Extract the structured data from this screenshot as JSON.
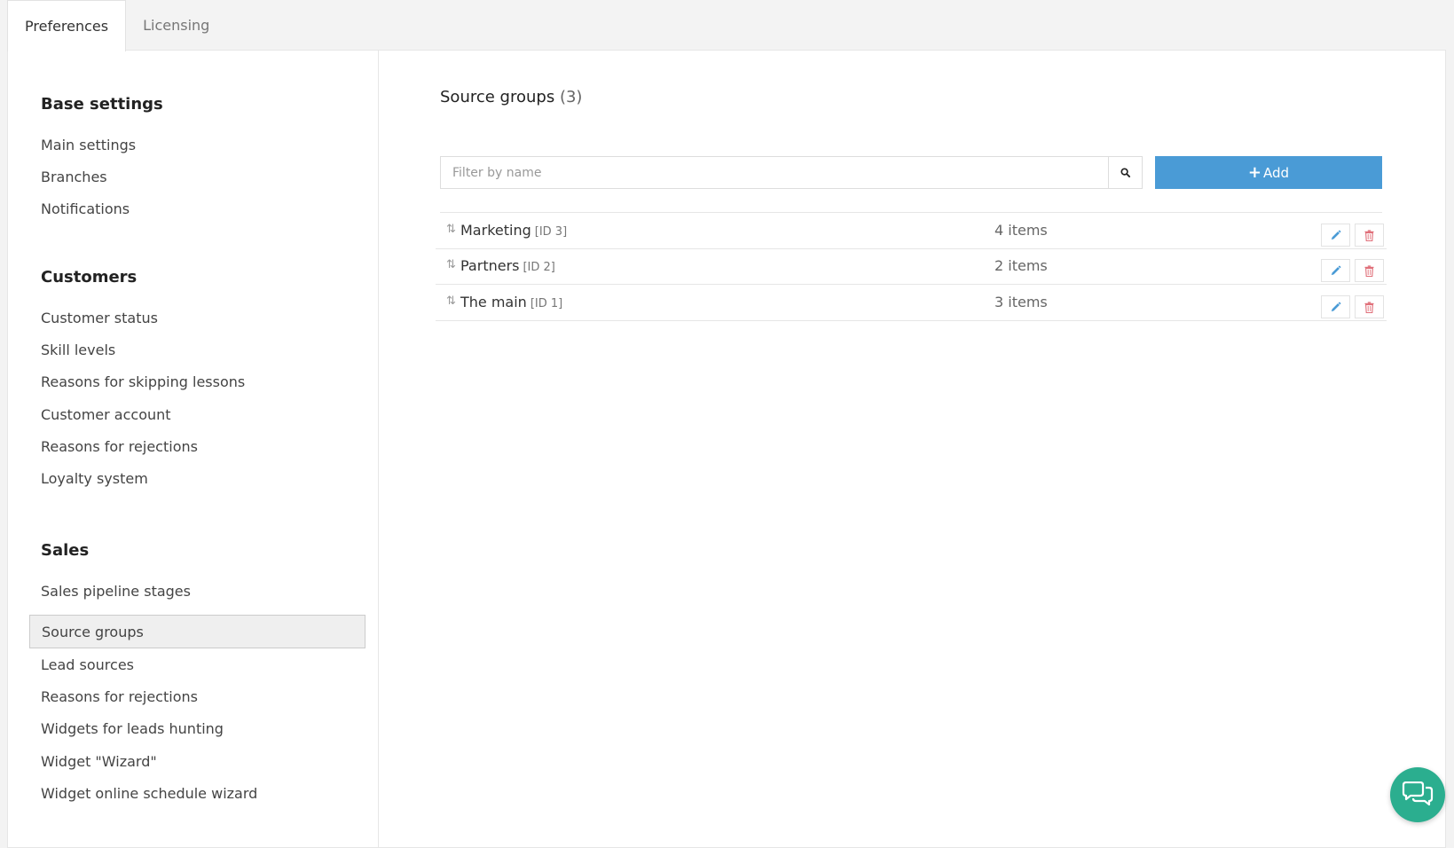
{
  "tabs": [
    {
      "label": "Preferences",
      "active": true
    },
    {
      "label": "Licensing",
      "active": false
    }
  ],
  "sidebar": {
    "sections": [
      {
        "title": "Base settings",
        "items": [
          "Main settings",
          "Branches",
          "Notifications"
        ]
      },
      {
        "title": "Customers",
        "items": [
          "Customer status",
          "Skill levels",
          "Reasons for skipping lessons",
          "Customer account",
          "Reasons for rejections",
          "Loyalty system"
        ]
      },
      {
        "title": "Sales",
        "items": [
          "Sales pipeline stages",
          "Source groups",
          "Lead sources",
          "Reasons for rejections",
          "Widgets for leads hunting",
          "Widget \"Wizard\"",
          "Widget online schedule wizard"
        ]
      }
    ],
    "active_item": "Source groups"
  },
  "content": {
    "title": "Source groups",
    "count": "(3)",
    "filter_placeholder": "Filter by name",
    "filter_value": "",
    "add_label": "Add",
    "rows": [
      {
        "name": "Marketing",
        "id": "[ID 3]",
        "items": "4 items"
      },
      {
        "name": "Partners",
        "id": "[ID 2]",
        "items": "2 items"
      },
      {
        "name": "The main",
        "id": "[ID 1]",
        "items": "3 items"
      }
    ]
  },
  "icons": {
    "search": "search-icon",
    "sort": "sort-arrows-icon",
    "edit": "pencil-icon",
    "delete": "trash-icon",
    "chat": "chat-bubbles-icon"
  },
  "colors": {
    "accent": "#4a9bd6",
    "delete": "#e0707a",
    "chat": "#2bae8f"
  }
}
